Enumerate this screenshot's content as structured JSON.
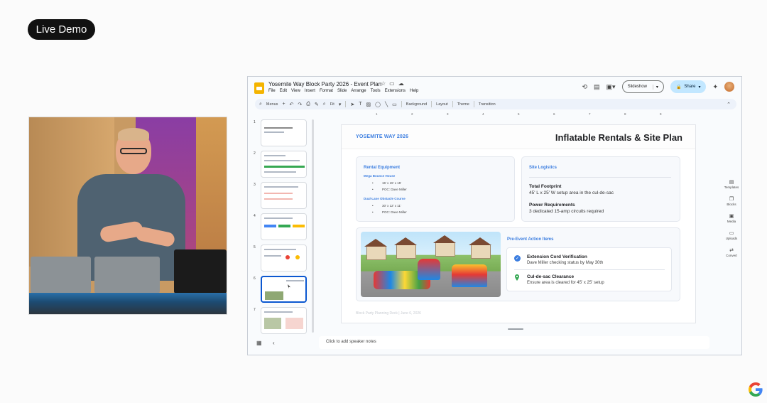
{
  "badge": {
    "label": "Live Demo"
  },
  "document": {
    "title": "Yosemite Way Block Party 2026 - Event Plan",
    "menu": [
      "File",
      "Edit",
      "View",
      "Insert",
      "Format",
      "Slide",
      "Arrange",
      "Tools",
      "Extensions",
      "Help"
    ],
    "slideshow_label": "Slideshow",
    "share_label": "Share"
  },
  "toolbar": {
    "menus_label": "Menus",
    "zoom_label": "Fit",
    "background_label": "Background",
    "layout_label": "Layout",
    "theme_label": "Theme",
    "transition_label": "Transition"
  },
  "ruler": [
    "1",
    "2",
    "3",
    "4",
    "5",
    "6",
    "7",
    "8",
    "9"
  ],
  "thumbnails": [
    "1",
    "2",
    "3",
    "4",
    "5",
    "6",
    "7"
  ],
  "active_slide": 6,
  "slide": {
    "brand": "YOSEMITE WAY 2026",
    "title": "Inflatable Rentals & Site Plan",
    "rental": {
      "heading": "Rental Equipment",
      "item1_name": "Mega Bounce House",
      "item1_size": "15' x 15' x 15'",
      "item1_poc": "POC: Dave Miller",
      "item2_name": "Dual-Lane Obstacle Course",
      "item2_size": "30' x 12' x 11'",
      "item2_poc": "POC: Dave Miller"
    },
    "logistics": {
      "heading": "Site Logistics",
      "footprint_h": "Total Footprint",
      "footprint_t": "45' L x 25' W setup area in the cul-de-sac",
      "power_h": "Power Requirements",
      "power_t": "3 dedicated 15-amp circuits required"
    },
    "actions": {
      "heading": "Pre-Event Action Items",
      "a1_h": "Extension Cord Verification",
      "a1_t": "Dave Miller checking status by May 30th",
      "a2_h": "Cul-de-sac Clearance",
      "a2_t": "Ensure area is cleared for 45' x 25' setup"
    },
    "footer": "Block Party Planning Deck | June 6, 2026"
  },
  "speaker_notes": "Click to add speaker notes",
  "side_panel": [
    "Templates",
    "Blocks",
    "Media",
    "Uploads",
    "Convert"
  ],
  "colors": {
    "accent": "#3c7ee0",
    "share_bg": "#c2e7ff",
    "badge_bg": "#111111"
  }
}
